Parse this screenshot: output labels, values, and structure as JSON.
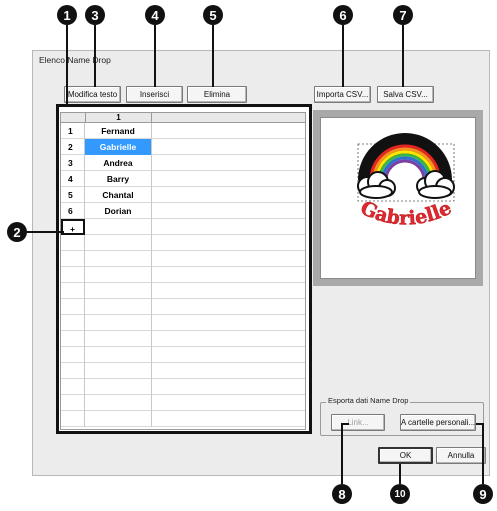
{
  "callouts": {
    "c1": "1",
    "c2": "2",
    "c3": "3",
    "c4": "4",
    "c5": "5",
    "c6": "6",
    "c7": "7",
    "c8": "8",
    "c9": "9",
    "c10": "10"
  },
  "window": {
    "title": "Elenco Name Drop"
  },
  "toolbar": {
    "edit_text": "Modifica testo",
    "insert": "Inserisci",
    "delete": "Elimina",
    "import_csv": "Importa CSV...",
    "save_csv": "Salva CSV..."
  },
  "list": {
    "column_header": "1",
    "rows": [
      {
        "num": "1",
        "name": "Fernand"
      },
      {
        "num": "2",
        "name": "Gabrielle"
      },
      {
        "num": "3",
        "name": "Andrea"
      },
      {
        "num": "4",
        "name": "Barry"
      },
      {
        "num": "5",
        "name": "Chantal"
      },
      {
        "num": "6",
        "name": "Dorian"
      }
    ],
    "new_row_marker": "+",
    "selected_index": 1
  },
  "preview": {
    "text": "Gabrielle"
  },
  "export": {
    "group_label": "Esporta dati Name Drop",
    "link": "Link...",
    "to_folders": "A cartelle personali..."
  },
  "footer": {
    "ok": "OK",
    "cancel": "Annulla"
  },
  "colors": {
    "selection": "#3399ff",
    "preview_text": "#e0282e",
    "rainbow": [
      "#e52521",
      "#f7931e",
      "#ffe600",
      "#3ab54a",
      "#2e6fd0",
      "#7b3fa0"
    ]
  }
}
